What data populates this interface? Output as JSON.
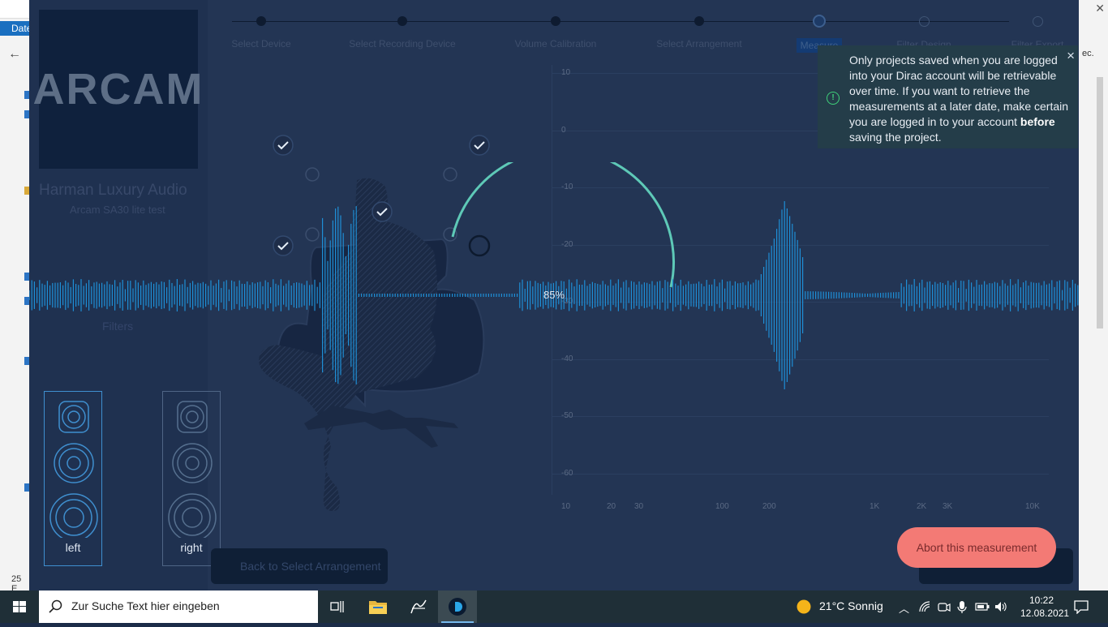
{
  "background_window": {
    "menu_label": "Date",
    "back_arrow": "←",
    "status_count": "25 E",
    "right_text": "ec."
  },
  "app": {
    "logo": "ARCAM",
    "brand": "Harman Luxury Audio",
    "subbrand": "Arcam SA30 lite test",
    "filters_label": "Filters",
    "speakers": [
      {
        "label": "left"
      },
      {
        "label": "right"
      }
    ],
    "steps": [
      {
        "label": "Select Device"
      },
      {
        "label": "Select Recording Device"
      },
      {
        "label": "Volume Calibration"
      },
      {
        "label": "Select Arrangement"
      },
      {
        "label": "Measure"
      },
      {
        "label": "Filter Design"
      },
      {
        "label": "Filter Export"
      }
    ],
    "progress_text": "85%",
    "progress_value": 0.85,
    "back_button": "Back to Select Arrangement",
    "abort_button": "Abort this measurement"
  },
  "notification": {
    "text_part1": "Only projects saved when you are logged into your Dirac account will be retrievable over time. If you want to retrieve the measurements at a later date, make certain you are logged in to your account ",
    "text_bold": "before",
    "text_part2": " saving the project.",
    "close": "×",
    "icon": "alert-circle-icon"
  },
  "chart_data": {
    "type": "line",
    "y_ticks": [
      "10",
      "0",
      "-10",
      "-20",
      "-30",
      "-40",
      "-50",
      "-60"
    ],
    "x_ticks": [
      "10",
      "20",
      "30",
      "100",
      "200",
      "1K",
      "2K",
      "3K",
      "10K",
      "20"
    ]
  },
  "taskbar": {
    "search_placeholder": "Zur Suche Text hier eingeben",
    "weather_temp": "21°C",
    "weather_desc": "Sonnig",
    "time": "10:22",
    "date": "12.08.2021"
  },
  "colors": {
    "accent": "#1e8fd6",
    "arc": "#5ec9b7",
    "abort": "#f37a75",
    "notif_icon": "#3fd17a"
  }
}
